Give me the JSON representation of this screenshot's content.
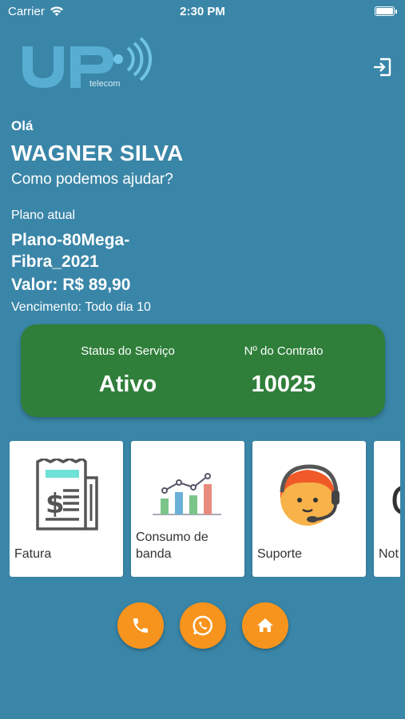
{
  "status_bar": {
    "carrier": "Carrier",
    "time": "2:30 PM"
  },
  "header": {
    "logo_text": "UP",
    "logo_sub": "telecom",
    "logout_icon": "logout-icon"
  },
  "greeting": {
    "hello": "Olá",
    "name": "WAGNER SILVA",
    "help": "Como podemos ajudar?"
  },
  "plan": {
    "label": "Plano atual",
    "name_line1": "Plano-80Mega-",
    "name_line2": "Fibra_2021",
    "value": "Valor: R$ 89,90",
    "due": "Vencimento: Todo dia 10"
  },
  "service": {
    "status_label": "Status do Serviço",
    "status_value": "Ativo",
    "contract_label": "Nº do Contrato",
    "contract_value": "10025",
    "card_color": "#2f7f3a"
  },
  "menu": [
    {
      "label": "Fatura",
      "icon": "invoice-icon"
    },
    {
      "label": "Consumo de banda",
      "icon": "bandwidth-chart-icon"
    },
    {
      "label": "Suporte",
      "icon": "support-agent-icon"
    },
    {
      "label": "Not",
      "icon": "notification-icon"
    }
  ],
  "actions": [
    {
      "icon": "phone-icon"
    },
    {
      "icon": "whatsapp-icon"
    },
    {
      "icon": "home-icon"
    }
  ],
  "colors": {
    "background": "#3a86a8",
    "accent": "#f7941d",
    "card": "#ffffff"
  }
}
